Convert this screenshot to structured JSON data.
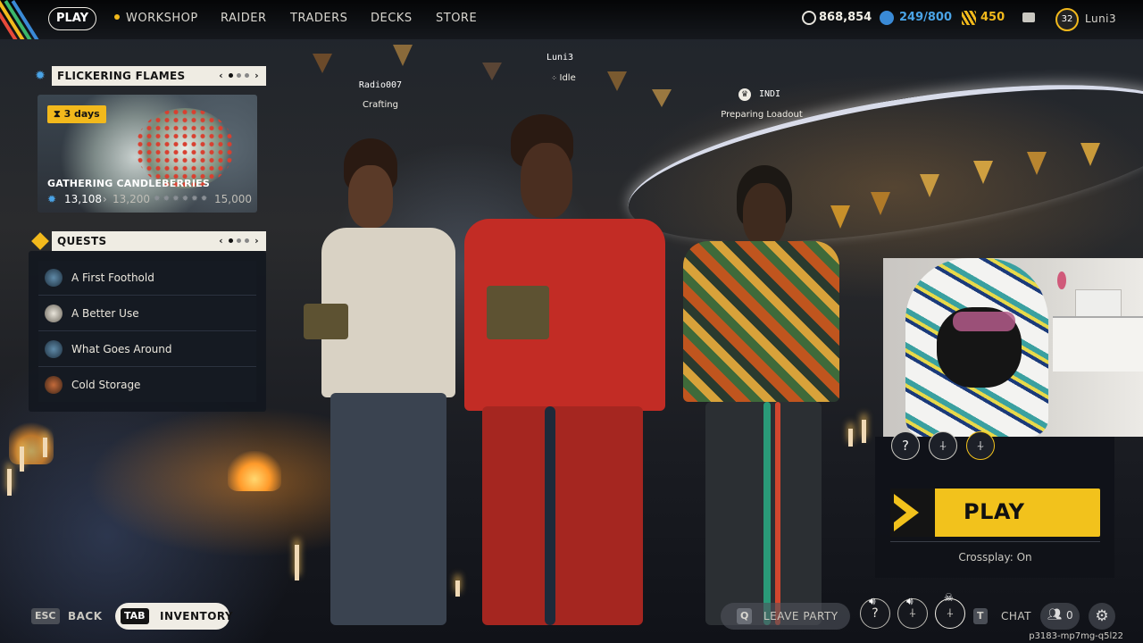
{
  "nav": {
    "play_label": "PLAY",
    "items": [
      "WORKSHOP",
      "RAIDER",
      "TRADERS",
      "DECKS",
      "STORE"
    ],
    "currency": {
      "coins": "868,854",
      "raider_tokens": "249/800",
      "cred": "450"
    },
    "player": {
      "level": "32",
      "name": "Luni3"
    }
  },
  "event": {
    "title": "FLICKERING FLAMES",
    "time_left": "3 days",
    "name": "GATHERING CANDLEBERRIES",
    "progress": "13,108",
    "next_milestone": "13,200",
    "goal": "15,000"
  },
  "quests": {
    "title": "QUESTS",
    "items": [
      "A First Foothold",
      "A Better Use",
      "What Goes Around",
      "Cold Storage"
    ]
  },
  "party": [
    {
      "name": "Radio007",
      "status": "Crafting"
    },
    {
      "name": "Luni3",
      "status": "Idle"
    },
    {
      "name": "INDI",
      "status": "Preparing Loadout"
    }
  ],
  "play_panel": {
    "button": "PLAY",
    "crossplay": "Crossplay: On"
  },
  "bottom": {
    "back_key": "ESC",
    "back_label": "BACK",
    "inventory_key": "TAB",
    "inventory_label": "INVENTORY",
    "leave_key": "Q",
    "leave_label": "LEAVE PARTY",
    "chat_key": "T",
    "chat_label": "CHAT",
    "friends_count": "0",
    "build": "p3183-mp7mg-q5l22"
  },
  "colors": {
    "accent": "#f2c21c",
    "panel_light": "#efece3"
  }
}
